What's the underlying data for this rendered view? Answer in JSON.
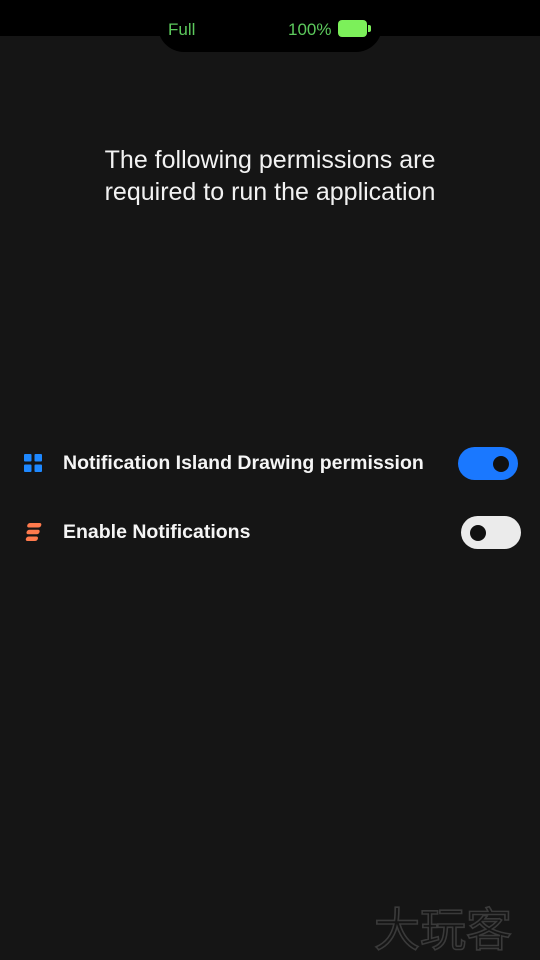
{
  "status_island": {
    "left_text": "Full",
    "battery_percent": "100%",
    "battery_level": 1.0,
    "text_color": "#5cc95c",
    "battery_color": "#7cf05a"
  },
  "heading": {
    "line1": "The following permissions are",
    "line2": "required to run the application"
  },
  "permissions": [
    {
      "icon": "grid-apps-icon",
      "label": "Notification Island Drawing permission",
      "enabled": true
    },
    {
      "icon": "stacked-bars-icon",
      "label": "Enable Notifications",
      "enabled": false
    }
  ],
  "colors": {
    "background": "#151515",
    "toggle_on": "#1a78ff",
    "toggle_off": "#ebebeb",
    "grid_icon": "#1e88ff",
    "bars_icon": "#ff7a4d"
  },
  "watermark": {
    "text": "大玩客"
  }
}
